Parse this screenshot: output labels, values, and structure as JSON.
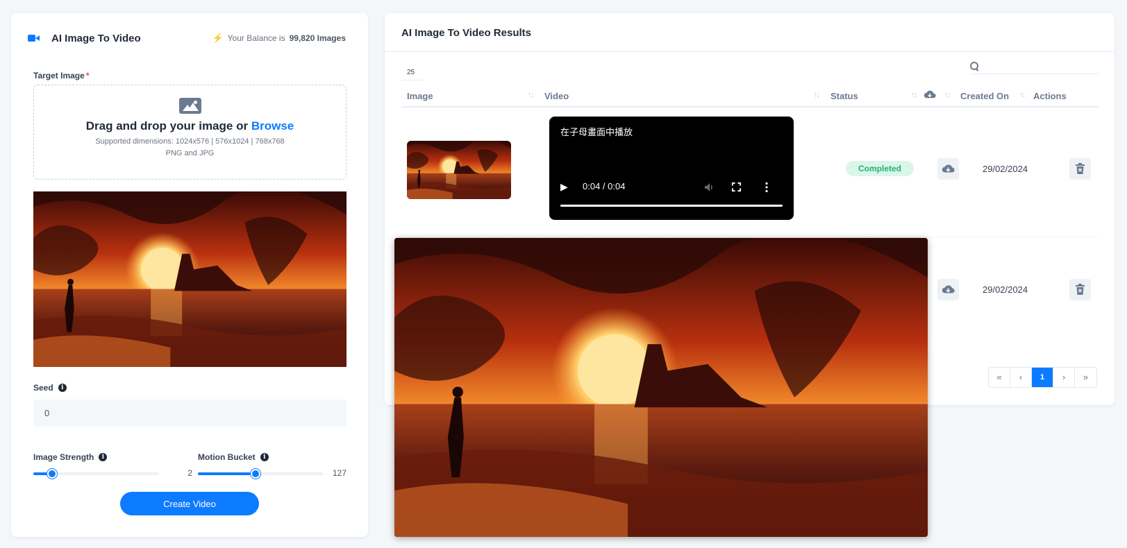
{
  "generator": {
    "title": "AI Image To Video",
    "balance_prefix": "Your Balance is",
    "balance_value": "99,820 Images",
    "target_label": "Target Image",
    "required_mark": "*",
    "dropzone_title": "Drag and drop your image or",
    "browse_label": "Browse",
    "supported_dims": "Supported dimensions: 1024x576 | 576x1024 | 768x768",
    "supported_types": "PNG and JPG",
    "seed_label": "Seed",
    "seed_value": "0",
    "image_strength_label": "Image Strength",
    "image_strength_value": "2",
    "image_strength_fraction": 0.15,
    "motion_bucket_label": "Motion Bucket",
    "motion_bucket_value": "127",
    "motion_bucket_fraction": 0.46,
    "create_button": "Create Video"
  },
  "results": {
    "title": "AI Image To Video Results",
    "page_size": "25",
    "columns": [
      "Image",
      "Video",
      "Status",
      "Created On",
      "Actions"
    ],
    "rows": [
      {
        "video_overlay_text": "在子母畫面中播放",
        "time": "0:04 / 0:04",
        "status": "Completed",
        "date": "29/02/2024"
      },
      {
        "date": "29/02/2024"
      }
    ],
    "pagination": [
      "«",
      "‹",
      "1",
      "›",
      "»"
    ]
  },
  "colors": {
    "accent": "#0d7bff",
    "status_completed_bg": "#dbf5ea",
    "status_completed_text": "#20b370"
  }
}
